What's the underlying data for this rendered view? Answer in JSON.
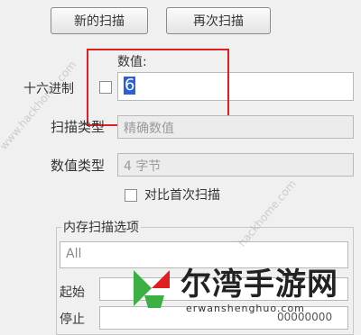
{
  "toolbar": {
    "new_scan_label": "新的扫描",
    "next_scan_label": "再次扫描"
  },
  "value_section": {
    "value_label": "数值:",
    "hex_label": "十六进制",
    "value_input": "6"
  },
  "scan_type": {
    "label": "扫描类型",
    "value": "精确数值"
  },
  "value_type": {
    "label": "数值类型",
    "value": "4 字节"
  },
  "compare_first": {
    "label": "对比首次扫描"
  },
  "memory_options": {
    "group_label": "内存扫描选项",
    "region_value": "All",
    "start_label": "起始",
    "stop_label": "停止",
    "stop_value": "00000000"
  },
  "watermark": {
    "diag_1": "www.hackhome.com",
    "diag_2": "hackhome.com",
    "brand_title": "尔湾手游网",
    "brand_url": "erwanshenghuo.com"
  },
  "colors": {
    "highlight": "#e02020",
    "logo_green": "#3cb043",
    "logo_red": "#e02020"
  }
}
